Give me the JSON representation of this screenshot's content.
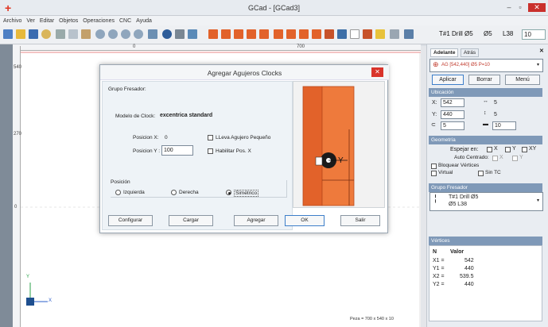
{
  "window": {
    "title": "GCad - [GCad3]"
  },
  "menu": [
    "Archivo",
    "Ver",
    "Editar",
    "Objetos",
    "Operaciones",
    "CNC",
    "Ayuda"
  ],
  "toolbar": {
    "tool_display": "T#1 Drill Ø5      Ø5      L38",
    "tool_width": "10"
  },
  "rulers": {
    "top": [
      "0",
      "700"
    ],
    "left": [
      "540",
      "270",
      "0"
    ]
  },
  "status": {
    "piece_size": "Peza = 700 x 540 x 10"
  },
  "dialog": {
    "title": "Agregar Agujeros Clocks",
    "group_label": "Grupo Fresador:",
    "model_label": "Modelo de Clock:",
    "model_value": "excentrica standard",
    "pos_x_label": "Posicion X:",
    "pos_x_value": "0",
    "pos_y_label": "Posicion Y :",
    "pos_y_value": "100",
    "check_small_hole": "LLeva Agujero Pequeño",
    "check_enable_x": "Habilitar Pos. X",
    "position_label": "Posición",
    "radio_left": "Izquierda",
    "radio_right": "Derecha",
    "radio_sym": "Simétrico",
    "btn_configure": "Configurar",
    "btn_load": "Cargar",
    "btn_add": "Agregar",
    "btn_ok": "OK",
    "btn_exit": "Salir",
    "preview_letter": "Y"
  },
  "panel": {
    "tab_forward": "Adelante",
    "tab_back": "Atrás",
    "selected_object": "AG [542,440] Ø5 P=10",
    "btn_apply": "Aplicar",
    "btn_delete": "Borrar",
    "btn_menu": "Menú",
    "sec_location": "Ubicación",
    "x_value": "542",
    "y_value": "440",
    "z_value": "5",
    "w_value": "5",
    "h_value": "5",
    "d_value": "10",
    "sec_geometry": "Geometría",
    "mirror_label": "Espejar en:",
    "opt_x": "X",
    "opt_y": "Y",
    "opt_xy": "XY",
    "auto_center_label": "Auto Centrado:",
    "lock_vertices": "Bloquear Vértices",
    "virtual": "Virtual",
    "no_tc": "Sin TC",
    "sec_group": "Grupo Fresador",
    "group_line1": "T#1 Drill Ø5",
    "group_line2": "Ø5       L38",
    "sec_vertices": "Vértices",
    "vertices_header_n": "N",
    "vertices_header_v": "Valor",
    "vertices": [
      {
        "n": "X1 =",
        "v": "542"
      },
      {
        "n": "Y1 =",
        "v": "440"
      },
      {
        "n": "X2 =",
        "v": "539.5"
      },
      {
        "n": "Y2 =",
        "v": "440"
      }
    ]
  },
  "colors": {
    "accent": "#7f99b8",
    "wood": "#e2622a",
    "close": "#c9302c"
  }
}
